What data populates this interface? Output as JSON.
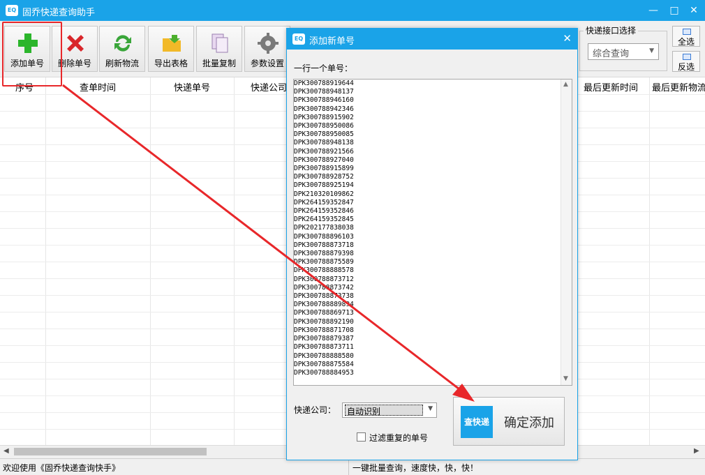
{
  "window": {
    "title": "固乔快递查询助手",
    "accent": "#1aa3e8"
  },
  "toolbar": {
    "buttons": [
      {
        "label": "添加单号",
        "icon": "plus-icon"
      },
      {
        "label": "删除单号",
        "icon": "x-icon"
      },
      {
        "label": "刷新物流",
        "icon": "refresh-icon"
      },
      {
        "label": "导出表格",
        "icon": "folder-export-icon"
      },
      {
        "label": "批量复制",
        "icon": "copy-icon"
      },
      {
        "label": "参数设置",
        "icon": "gear-icon"
      }
    ],
    "api_group_label": "快递接口选择",
    "api_selected": "综合查询",
    "select_all": "全选",
    "invert_select": "反选"
  },
  "table": {
    "headers": [
      "序号",
      "查单时间",
      "快递单号",
      "快递公司",
      "最后更新时间",
      "最后更新物流"
    ]
  },
  "status": {
    "left": "欢迎使用《固乔快递查询快手》",
    "right": "一键批量查询，速度快，快，快！"
  },
  "dialog": {
    "title": "添加新单号",
    "prompt": "一行一个单号：",
    "tracking_numbers": [
      "DPK300788919644",
      "DPK300788948137",
      "DPK300788946160",
      "DPK300788942346",
      "DPK300788915902",
      "DPK300788950086",
      "DPK300788950085",
      "DPK300788948138",
      "DPK300788921566",
      "DPK300788927040",
      "DPK300788915899",
      "DPK300788928752",
      "DPK300788925194",
      "DPK210320109862",
      "DPK264159352847",
      "DPK264159352846",
      "DPK264159352845",
      "DPK202177838038",
      "DPK300788896103",
      "DPK300788873718",
      "DPK300788879398",
      "DPK300788875589",
      "DPK300788888578",
      "DPK300788873712",
      "DPK300788873742",
      "DPK300788873738",
      "DPK300788889894",
      "DPK300788869713",
      "DPK300788892190",
      "DPK300788871708",
      "DPK300788879387",
      "DPK300788873711",
      "DPK300788888580",
      "DPK300788875584",
      "DPK300788884953"
    ],
    "company_label": "快递公司：",
    "company_value": "自动识别",
    "filter_label": "过滤重复的单号",
    "filter_checked": false,
    "confirm_logo": "查快递",
    "confirm_label": "确定添加"
  },
  "annotation": {
    "color": "#e8272a"
  }
}
